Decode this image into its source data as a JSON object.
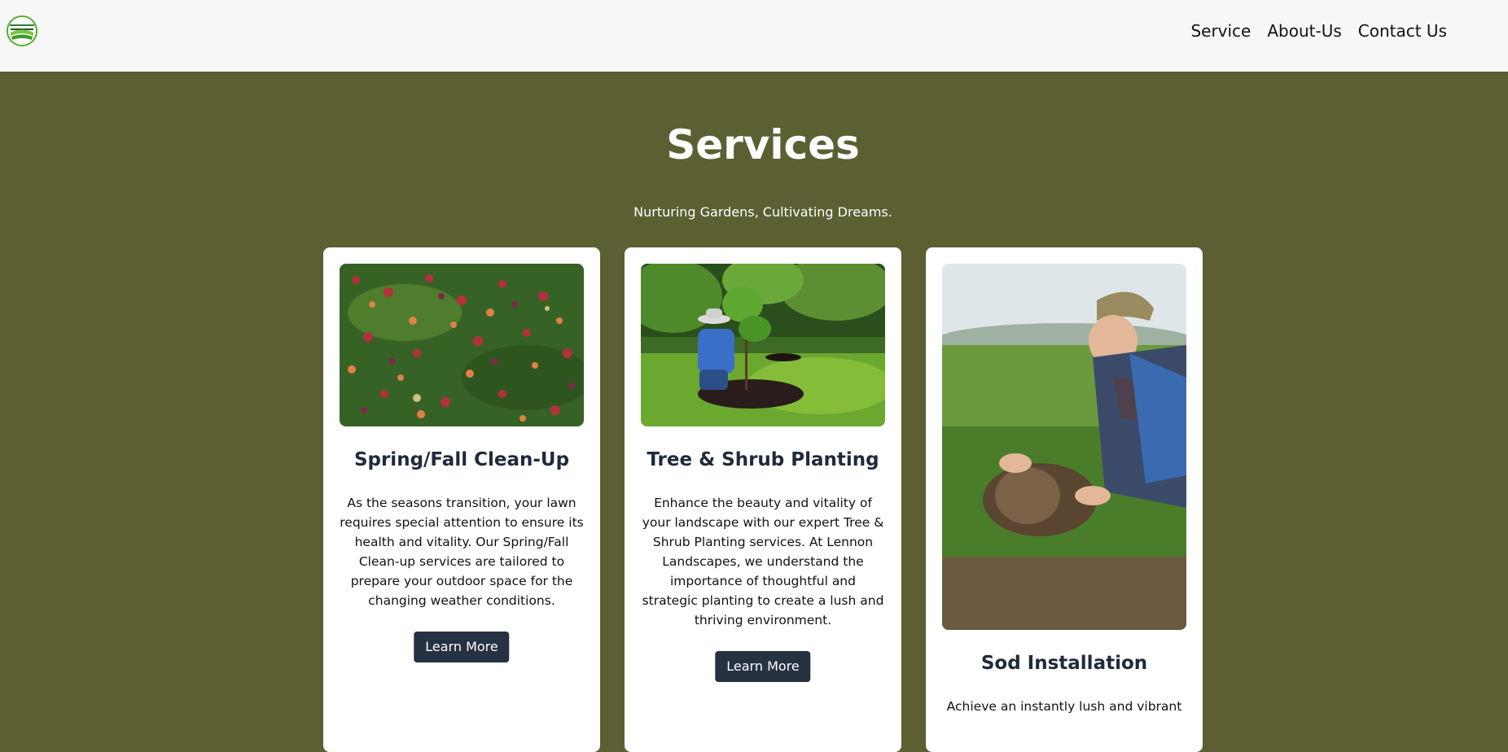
{
  "header": {
    "logo_name": "leaf-logo",
    "nav": [
      "Service",
      "About-Us",
      "Contact Us"
    ]
  },
  "hero": {
    "title": "Services",
    "subtitle": "Nurturing Gardens, Cultivating Dreams."
  },
  "cards": [
    {
      "title": "Spring/Fall Clean-Up",
      "text": "As the seasons transition, your lawn requires special attention to ensure its health and vitality. Our Spring/Fall Clean-up services are tailored to prepare your outdoor space for the changing weather conditions.",
      "button": "Learn More",
      "image": "autumn-leaves-on-grass"
    },
    {
      "title": "Tree & Shrub Planting",
      "text": "Enhance the beauty and vitality of your landscape with our expert Tree & Shrub Planting services. At Lennon Landscapes, we understand the importance of thoughtful and strategic planting to create a lush and thriving environment.",
      "button": "Learn More",
      "image": "person-planting-tree"
    },
    {
      "title": "Sod Installation",
      "text": "Achieve an instantly lush and vibrant",
      "image": "person-laying-sod"
    }
  ],
  "colors": {
    "background": "#5b5f32",
    "header": "#f7f7f7",
    "button": "#263142",
    "card_title": "#1f2a3a"
  }
}
